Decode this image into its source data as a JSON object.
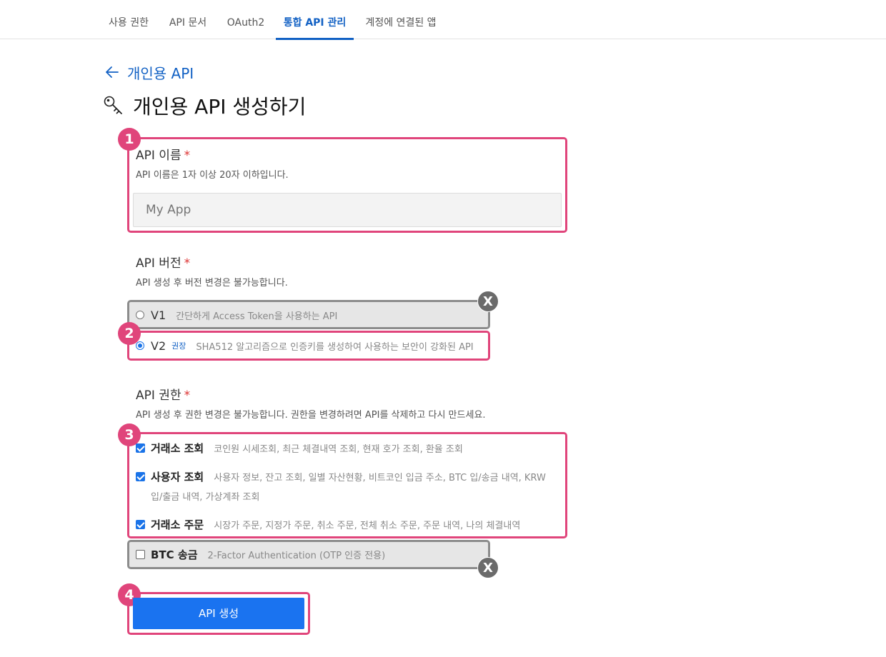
{
  "tabs": [
    {
      "label": "사용 권한",
      "active": false
    },
    {
      "label": "API 문서",
      "active": false
    },
    {
      "label": "OAuth2",
      "active": false
    },
    {
      "label": "통합 API 관리",
      "active": true
    },
    {
      "label": "계정에 연결된 앱",
      "active": false
    }
  ],
  "back_link": "개인용 API",
  "page_title": "개인용 API 생성하기",
  "name_section": {
    "label": "API 이름",
    "required_mark": "*",
    "description": "API 이름은 1자 이상 20자 이하입니다.",
    "placeholder": "My App"
  },
  "version_section": {
    "label": "API 버전",
    "required_mark": "*",
    "description": "API 생성 후 버전 변경은 불가능합니다.",
    "options": [
      {
        "name": "V1",
        "tag": "",
        "desc": "간단하게 Access Token을 사용하는 API",
        "selected": false
      },
      {
        "name": "V2",
        "tag": "권장",
        "desc": "SHA512 알고리즘으로 인증키를 생성하여 사용하는 보안이 강화된 API",
        "selected": true
      }
    ]
  },
  "permission_section": {
    "label": "API 권한",
    "required_mark": "*",
    "description": "API 생성 후 권한 변경은 불가능합니다. 권한을 변경하려면 API를 삭제하고 다시 만드세요.",
    "items": [
      {
        "name": "거래소 조회",
        "desc": "코인원 시세조회, 최근 체결내역 조회, 현재 호가 조회, 환율 조회",
        "desc2": "",
        "checked": true
      },
      {
        "name": "사용자 조회",
        "desc": "사용자 정보, 잔고 조회, 일별 자산현황, 비트코인 입금 주소, BTC 입/송금 내역, KRW",
        "desc2": "입/출금 내역, 가상계좌 조회",
        "checked": true
      },
      {
        "name": "거래소 주문",
        "desc": "시장가 주문, 지정가 주문, 취소 주문, 전체 취소 주문, 주문 내역, 나의 체결내역",
        "desc2": "",
        "checked": true
      },
      {
        "name": "BTC 송금",
        "desc": "2-Factor Authentication (OTP 인증 전용)",
        "desc2": "",
        "checked": false
      }
    ]
  },
  "submit_label": "API 생성",
  "annotations": {
    "numbers": [
      "1",
      "2",
      "3",
      "4"
    ],
    "cross": "X"
  },
  "colors": {
    "accent_blue": "#1261c4",
    "button_blue": "#1a73f0",
    "highlight_pink": "#e0457b",
    "highlight_gray": "#8c8c8c"
  }
}
